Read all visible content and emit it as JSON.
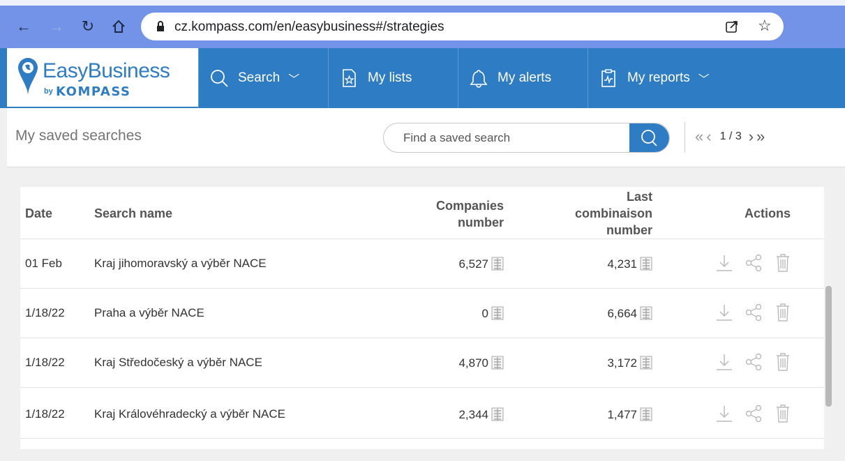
{
  "browser": {
    "url": "cz.kompass.com/en/easybusiness#/strategies"
  },
  "logo": {
    "name": "EasyBusiness",
    "by": "by",
    "brand": "KOMPASS"
  },
  "menu": [
    {
      "label": "Search",
      "icon": "search-icon",
      "has_dropdown": true
    },
    {
      "label": "My lists",
      "icon": "list-star-icon",
      "has_dropdown": false
    },
    {
      "label": "My alerts",
      "icon": "bell-icon",
      "has_dropdown": false
    },
    {
      "label": "My reports",
      "icon": "report-icon",
      "has_dropdown": true
    }
  ],
  "page": {
    "title": "My saved searches",
    "search_placeholder": "Find a saved search",
    "pager": {
      "text": "1 / 3"
    }
  },
  "table": {
    "headers": {
      "date": "Date",
      "name": "Search name",
      "companies": "Companies number",
      "last": "Last combinaison number",
      "actions": "Actions"
    },
    "rows": [
      {
        "date": "01 Feb",
        "name": "Kraj jihomoravský a výběr NACE",
        "companies": "6,527",
        "last": "4,231"
      },
      {
        "date": "1/18/22",
        "name": "Praha a výběr NACE",
        "companies": "0",
        "last": "6,664"
      },
      {
        "date": "1/18/22",
        "name": "Kraj Středočeský a výběr NACE",
        "companies": "4,870",
        "last": "3,172"
      },
      {
        "date": "1/18/22",
        "name": "Kraj Královéhradecký a výběr NACE",
        "companies": "2,344",
        "last": "1,477"
      }
    ]
  },
  "colors": {
    "brand_blue": "#2e7cc4",
    "chrome_blue": "#7393e8"
  }
}
